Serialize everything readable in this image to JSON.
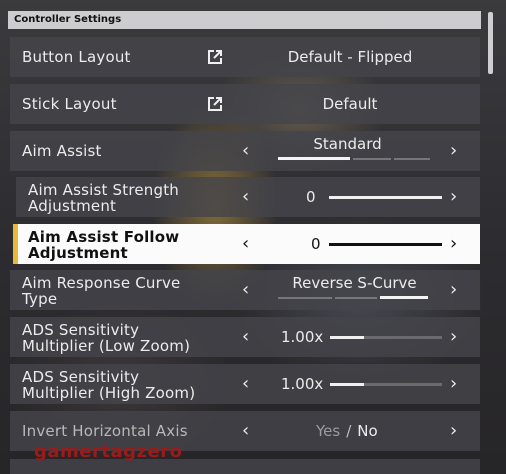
{
  "header": {
    "title": "Controller Settings"
  },
  "rows": {
    "button_layout": {
      "label": "Button Layout",
      "value": "Default - Flipped"
    },
    "stick_layout": {
      "label": "Stick Layout",
      "value": "Default"
    },
    "aim_assist": {
      "label": "Aim Assist",
      "value": "Standard",
      "options_count": 3,
      "selected_index": 0
    },
    "aim_strength": {
      "label_line1": "Aim Assist Strength",
      "label_line2": "Adjustment",
      "value": "0",
      "level": 0
    },
    "aim_follow": {
      "label_line1": "Aim Assist Follow",
      "label_line2": "Adjustment",
      "value": "0",
      "level": 0
    },
    "response_curve": {
      "label_line1": "Aim Response Curve",
      "label_line2": "Type",
      "value": "Reverse S-Curve",
      "options_count": 3,
      "selected_index": 2
    },
    "ads_low": {
      "label_line1": "ADS Sensitivity",
      "label_line2": "Multiplier (Low Zoom)",
      "value": "1.00x",
      "level": 0.3
    },
    "ads_high": {
      "label_line1": "ADS Sensitivity",
      "label_line2": "Multiplier (High Zoom)",
      "value": "1.00x",
      "level": 0.3
    },
    "invert_horizontal": {
      "label": "Invert Horizontal Axis",
      "option_yes": "Yes",
      "separator": "/",
      "option_no": "No",
      "selected": "No"
    }
  },
  "icons": {
    "left": "chevron-left-icon",
    "right": "chevron-right-icon",
    "external": "external-link-icon"
  },
  "watermark": "gamertagzero",
  "colors": {
    "accent": "#e7b93a",
    "watermark": "#9b1b1b"
  }
}
